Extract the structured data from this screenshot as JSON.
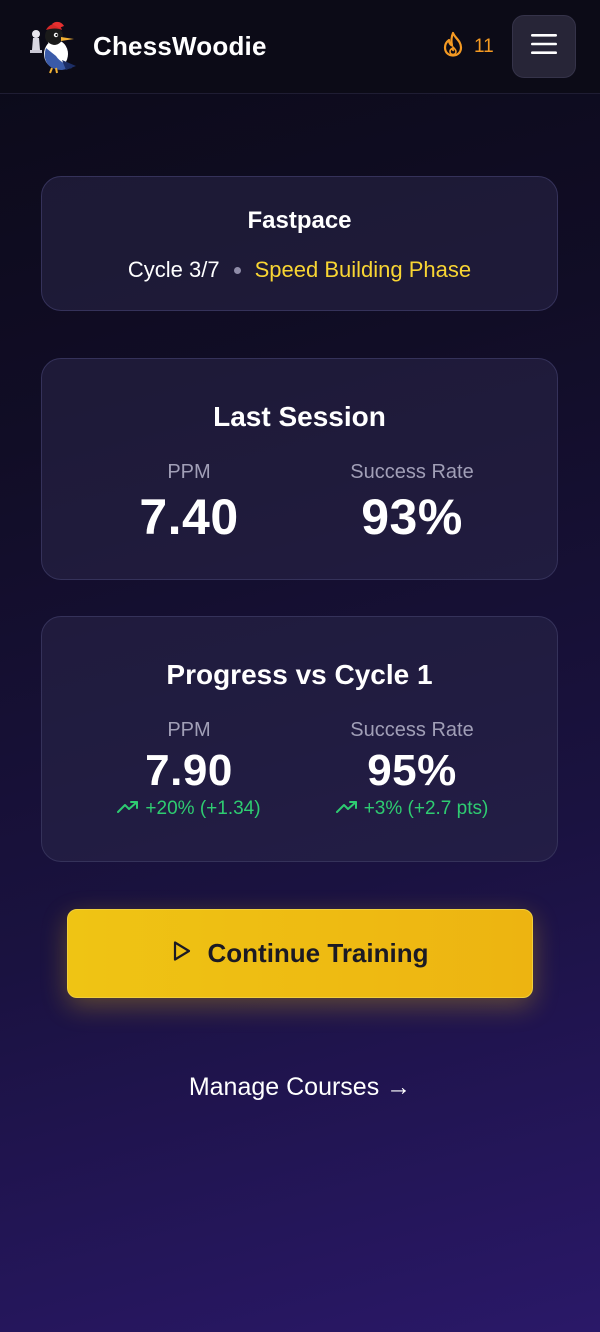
{
  "header": {
    "brand": "ChessWoodie",
    "streak_count": "11",
    "streak_icon": "flame-icon",
    "menu_icon": "hamburger-menu-icon"
  },
  "course": {
    "name": "Fastpace",
    "cycle": "Cycle 3/7",
    "phase": "Speed Building Phase"
  },
  "last_session": {
    "title": "Last Session",
    "ppm_label": "PPM",
    "ppm_value": "7.40",
    "success_label": "Success Rate",
    "success_value": "93%"
  },
  "progress": {
    "title": "Progress vs Cycle 1",
    "ppm_label": "PPM",
    "ppm_value": "7.90",
    "ppm_delta": "+20% (+1.34)",
    "success_label": "Success Rate",
    "success_value": "95%",
    "success_delta": "+3% (+2.7 pts)"
  },
  "actions": {
    "continue_label": "Continue Training",
    "manage_label": "Manage Courses →"
  },
  "colors": {
    "accent_yellow": "#efc414",
    "phase_yellow": "#f8d533",
    "streak_orange": "#f59a22",
    "positive_green": "#2ecc71"
  }
}
